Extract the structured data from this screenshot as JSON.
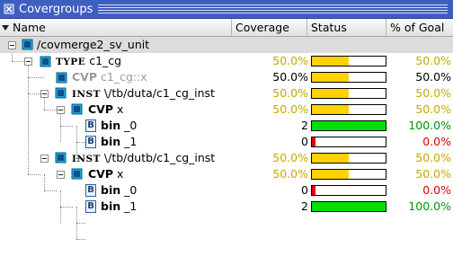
{
  "window": {
    "title": "Covergroups"
  },
  "columns": {
    "name": "Name",
    "coverage": "Coverage",
    "status": "Status",
    "goal": "% of Goal"
  },
  "colors": {
    "yellow_text": "#c8a800",
    "red_text": "#e00000",
    "green_text": "#009600",
    "bar_yellow": "#ffd200",
    "bar_green": "#00e000",
    "bar_red": "#e00000"
  },
  "rows": [
    {
      "kind": "root",
      "label": "/covmerge2_sv_unit",
      "icon": "folder-cube-icon"
    },
    {
      "kind": "type",
      "keyword": "TYPE",
      "label": "c1_cg",
      "icon": "covergroup-icon",
      "coverage": "50.0%",
      "status_fraction": 0.5,
      "goal": "50.0%",
      "tone": "yellow"
    },
    {
      "kind": "cvp-gray",
      "keyword": "CVP",
      "label": "c1_cg::x",
      "icon": "coverpoint-icon",
      "coverage": "50.0%",
      "status_fraction": 0.5,
      "goal": "50.0%",
      "tone": "black"
    },
    {
      "kind": "inst",
      "keyword": "INST",
      "label": "\\/tb/duta/c1_cg_inst",
      "icon": "instance-icon",
      "coverage": "50.0%",
      "status_fraction": 0.5,
      "goal": "50.0%",
      "tone": "yellow"
    },
    {
      "kind": "cvp",
      "keyword": "CVP",
      "label": "x",
      "icon": "coverpoint-icon",
      "coverage": "50.0%",
      "status_fraction": 0.5,
      "goal": "50.0%",
      "tone": "yellow"
    },
    {
      "kind": "bin",
      "keyword": "bin",
      "label": "_0",
      "icon": "bin-icon",
      "coverage": "2",
      "status_fraction": 1.0,
      "goal": "100.0%",
      "tone": "green"
    },
    {
      "kind": "bin",
      "keyword": "bin",
      "label": "_1",
      "icon": "bin-icon",
      "coverage": "0",
      "status_fraction": 0.0,
      "goal": "0.0%",
      "tone": "red"
    },
    {
      "kind": "inst",
      "keyword": "INST",
      "label": "\\/tb/dutb/c1_cg_inst",
      "icon": "instance-icon",
      "coverage": "50.0%",
      "status_fraction": 0.5,
      "goal": "50.0%",
      "tone": "yellow"
    },
    {
      "kind": "cvp",
      "keyword": "CVP",
      "label": "x",
      "icon": "coverpoint-icon",
      "coverage": "50.0%",
      "status_fraction": 0.5,
      "goal": "50.0%",
      "tone": "yellow"
    },
    {
      "kind": "bin",
      "keyword": "bin",
      "label": "_0",
      "icon": "bin-icon",
      "coverage": "0",
      "status_fraction": 0.0,
      "goal": "0.0%",
      "tone": "red"
    },
    {
      "kind": "bin",
      "keyword": "bin",
      "label": "_1",
      "icon": "bin-icon",
      "coverage": "2",
      "status_fraction": 1.0,
      "goal": "100.0%",
      "tone": "green"
    }
  ]
}
